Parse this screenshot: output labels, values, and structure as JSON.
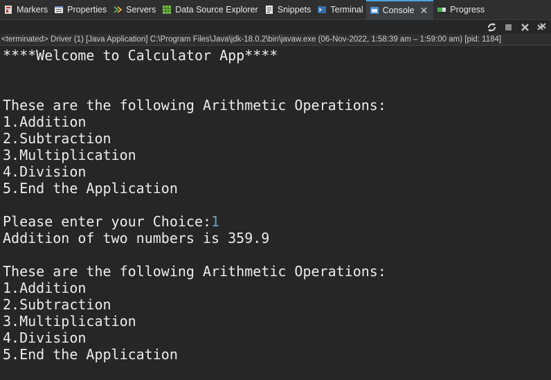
{
  "tabs": [
    {
      "label": "Markers",
      "icon": "markers-icon"
    },
    {
      "label": "Properties",
      "icon": "properties-icon"
    },
    {
      "label": "Servers",
      "icon": "servers-icon"
    },
    {
      "label": "Data Source Explorer",
      "icon": "data-source-icon"
    },
    {
      "label": "Snippets",
      "icon": "snippets-icon"
    },
    {
      "label": "Terminal",
      "icon": "terminal-icon"
    },
    {
      "label": "Console",
      "icon": "console-icon",
      "active": true
    },
    {
      "label": "Progress",
      "icon": "progress-icon"
    }
  ],
  "toolbar": {
    "icons": [
      "sync-icon",
      "stop-icon",
      "remove-launch-icon",
      "remove-all-icon"
    ]
  },
  "status": "<terminated> Driver (1) [Java Application] C:\\Program Files\\Java\\jdk-18.0.2\\bin\\javaw.exe  (06-Nov-2022, 1:58:39 am – 1:59:00 am) [pid: 1184]",
  "console": {
    "welcome": "****Welcome to Calculator App****",
    "menu_header_1": "These are the following Arithmetic Operations:",
    "opt1_1": "1.Addition",
    "opt2_1": "2.Subtraction",
    "opt3_1": "3.Multiplication",
    "opt4_1": "4.Division",
    "opt5_1": "5.End the Application",
    "prompt": "Please enter your Choice:",
    "prompt_input": "1",
    "result": "Addition of two numbers is 359.9",
    "menu_header_2": "These are the following Arithmetic Operations:",
    "opt1_2": "1.Addition",
    "opt2_2": "2.Subtraction",
    "opt3_2": "3.Multiplication",
    "opt4_2": "4.Division",
    "opt5_2": "5.End the Application"
  }
}
